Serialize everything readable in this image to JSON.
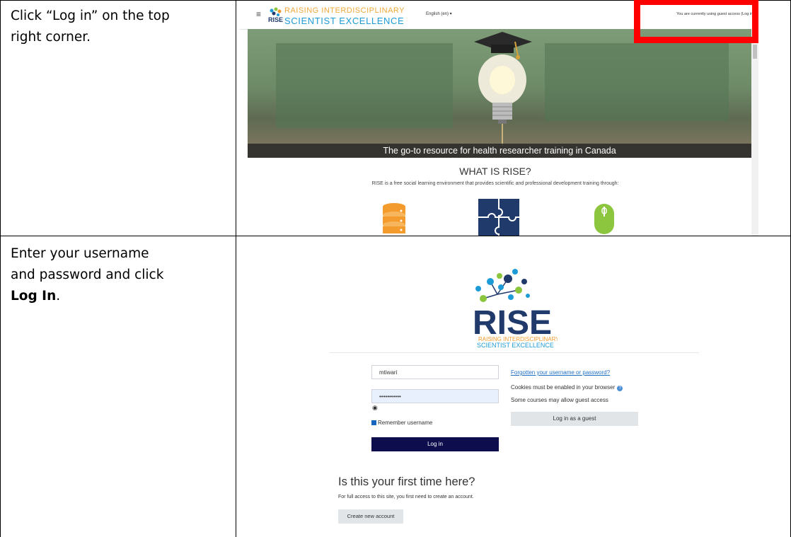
{
  "rows": [
    {
      "instruction_lines": [
        "Click “Log in” on the top",
        "right corner."
      ]
    },
    {
      "instruction_lines": [
        "Enter your username",
        "and password and click"
      ],
      "instruction_bold": "Log In",
      "instruction_tail": "."
    }
  ],
  "shot1": {
    "brand_line1": "RAISING INTERDISCIPLINARY",
    "brand_line2": "SCIENTIST EXCELLENCE",
    "logo_text": "RISE",
    "language": "English (en) ▾",
    "guest_access": "You are currently using guest access (Log in)",
    "hero_caption": "The go-to resource for health researcher training in Canada",
    "heading": "WHAT IS RISE?",
    "subheading": "RISE is a free social learning environment that provides scientific and professional development training through:",
    "colors": {
      "orange": "#f39c2d",
      "navy": "#1f3a6b",
      "green": "#8cc63f",
      "highlight": "#ff0000"
    }
  },
  "shot2": {
    "logo_text": "RISE",
    "logo_sub1": "RAISING INTERDISCIPLINARY",
    "logo_sub2": "SCIENTIST EXCELLENCE",
    "username_value": "mtiwari",
    "password_value": "•••••••••••",
    "remember_label": "Remember username",
    "login_button": "Log in",
    "forgot_link": "Forgotten your username or password?",
    "cookies_text": "Cookies must be enabled in your browser",
    "guest_text": "Some courses may allow guest access",
    "guest_button": "Log in as a guest",
    "first_time_heading": "Is this your first time here?",
    "first_time_text": "For full access to this site, you first need to create an account.",
    "create_button": "Create new account"
  }
}
